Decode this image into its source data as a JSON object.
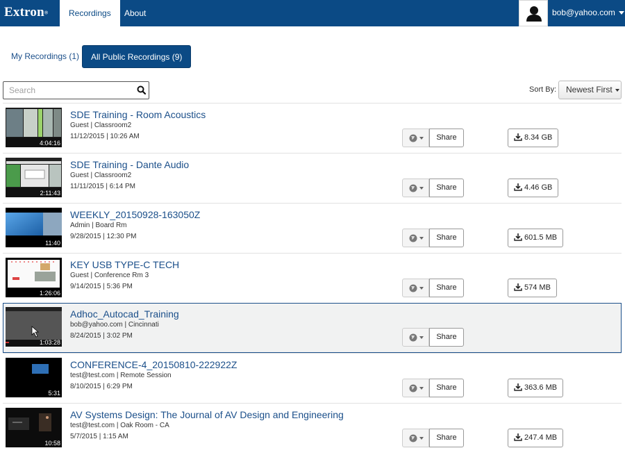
{
  "nav": {
    "logo": "Extron",
    "logo_mark": "®",
    "tabs": [
      "Recordings",
      "About"
    ],
    "user": "bob@yahoo.com"
  },
  "filters": {
    "my": "My Recordings (1)",
    "all": "All Public Recordings (9)"
  },
  "search": {
    "placeholder": "Search"
  },
  "sort": {
    "label": "Sort By:",
    "value": "Newest First"
  },
  "recordings": [
    {
      "title": "SDE Training - Room Acoustics",
      "meta": "Guest | Classroom2",
      "date": "11/12/2015 | 10:26 AM",
      "duration": "4:04:16",
      "size": "8.34 GB"
    },
    {
      "title": "SDE Training - Dante Audio",
      "meta": "Guest | Classroom2",
      "date": "11/11/2015 | 6:14 PM",
      "duration": "2:11:43",
      "size": "4.46 GB"
    },
    {
      "title": "WEEKLY_20150928-163050Z",
      "meta": "Admin | Board Rm",
      "date": "9/28/2015 | 12:30 PM",
      "duration": "11:40",
      "size": "601.5 MB"
    },
    {
      "title": "KEY USB TYPE-C TECH",
      "meta": "Guest | Conference Rm 3",
      "date": "9/14/2015 | 5:36 PM",
      "duration": "1:26:06",
      "size": "574 MB"
    },
    {
      "title": "Adhoc_Autocad_Training",
      "meta": "bob@yahoo.com | Cincinnati",
      "date": "8/24/2015 | 3:02 PM",
      "duration": "1:03:28",
      "size": ""
    },
    {
      "title": "CONFERENCE-4_20150810-222922Z",
      "meta": "test@test.com | Remote Session",
      "date": "8/10/2015 | 6:29 PM",
      "duration": "5:31",
      "size": "363.6 MB"
    },
    {
      "title": "AV Systems Design: The Journal of AV Design and Engineering",
      "meta": "test@test.com | Oak Room - CA",
      "date": "5/7/2015 | 1:15 AM",
      "duration": "10:58",
      "size": "247.4 MB"
    }
  ],
  "share_label": "Share",
  "colors": {
    "navbar": "#0b4a85",
    "link": "#1b4f8a",
    "selected_row": "#f1f2f2"
  }
}
